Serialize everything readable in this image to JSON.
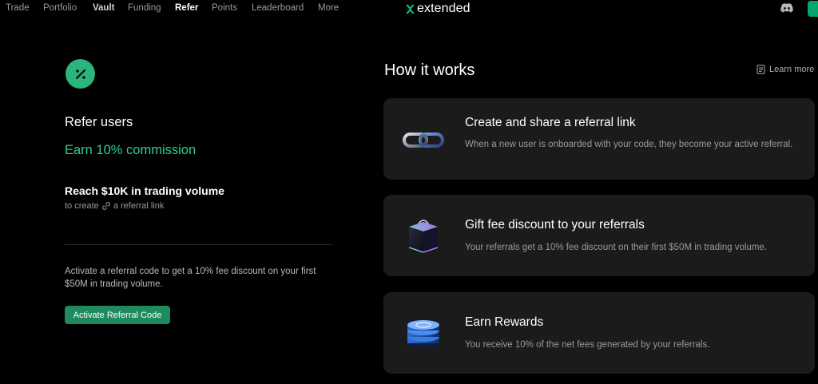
{
  "nav": {
    "items": [
      "Trade",
      "Portfolio",
      "Vault",
      "Funding",
      "Refer",
      "Points",
      "Leaderboard",
      "More"
    ],
    "active": "Refer"
  },
  "brand": {
    "name": "extended",
    "accent": "#00c07a"
  },
  "left": {
    "title": "Refer users",
    "commission": "Earn 10% commission",
    "requirement": "Reach $10K in trading volume",
    "sub_prefix": "to create",
    "sub_suffix": "a referral link",
    "activate_description": "Activate a referral code to get a 10% fee discount on your first $50M in trading volume.",
    "activate_button": "Activate Referral Code"
  },
  "right": {
    "title": "How it works",
    "learn_more": "Learn more",
    "cards": [
      {
        "icon": "chain-link-icon",
        "title": "Create and share a referral link",
        "description": "When a new user is onboarded with your code, they become your active referral."
      },
      {
        "icon": "gift-cube-icon",
        "title": "Gift fee discount to your referrals",
        "description": "Your referrals get a 10% fee discount on their first $50M in trading volume."
      },
      {
        "icon": "coin-stack-icon",
        "title": "Earn Rewards",
        "description": "You receive 10% of the net fees generated by your referrals."
      }
    ]
  },
  "colors": {
    "background": "#000000",
    "card": "#1b1b1b",
    "green": "#2fcf8a",
    "button": "#1f8a5d"
  }
}
